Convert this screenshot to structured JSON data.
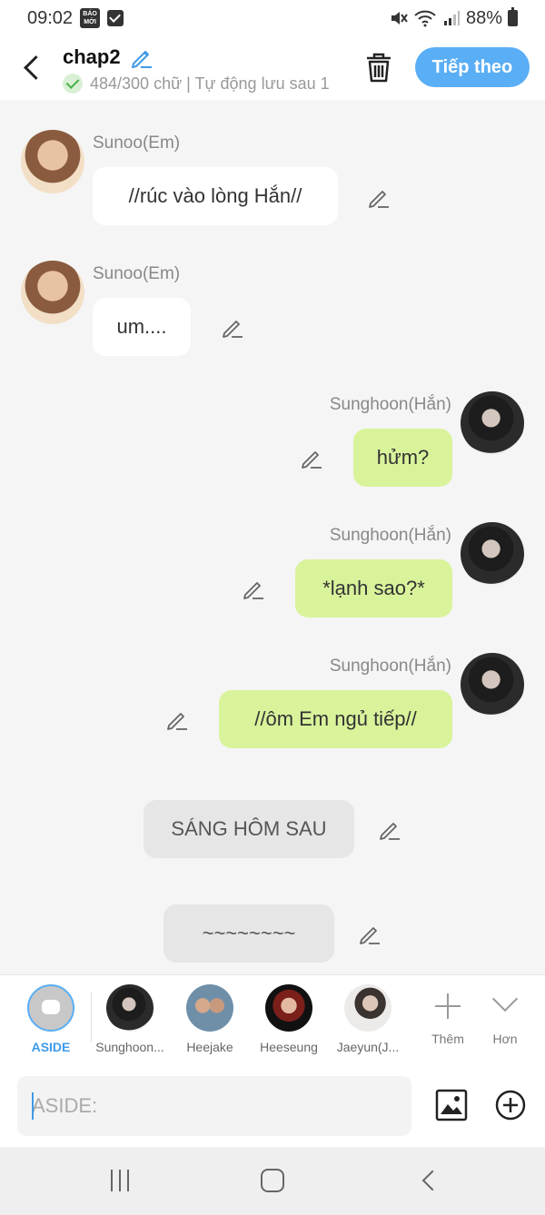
{
  "status_bar": {
    "time": "09:02",
    "news_badge": "BÁO MỚI",
    "battery": "88%"
  },
  "header": {
    "title": "chap2",
    "subtitle": "484/300 chữ | Tự động lưu sau 1",
    "next_button": "Tiếp theo"
  },
  "messages": [
    {
      "sender": "Sunoo(Em)",
      "text": "//rúc vào lòng Hắn//"
    },
    {
      "sender": "Sunoo(Em)",
      "text": "um...."
    },
    {
      "sender": "Sunghoon(Hắn)",
      "text": "hửm?"
    },
    {
      "sender": "Sunghoon(Hắn)",
      "text": "*lạnh sao?*"
    },
    {
      "sender": "Sunghoon(Hắn)",
      "text": "//ôm Em ngủ tiếp//"
    },
    {
      "sender": "",
      "text": "SÁNG HÔM SAU"
    },
    {
      "sender": "",
      "text": "~~~~~~~~"
    }
  ],
  "characters": [
    {
      "name": "ASIDE"
    },
    {
      "name": "Sunghoon..."
    },
    {
      "name": "Heejake"
    },
    {
      "name": "Heeseung"
    },
    {
      "name": "Jaeyun(J..."
    }
  ],
  "tools": {
    "add_label": "Thêm",
    "more_label": "Hơn"
  },
  "input": {
    "placeholder": "ASIDE:"
  },
  "colors": {
    "accent": "#5aaef5",
    "bubble_green": "#d9f39b",
    "bubble_white": "#ffffff",
    "bubble_gray": "#e6e6e6"
  }
}
